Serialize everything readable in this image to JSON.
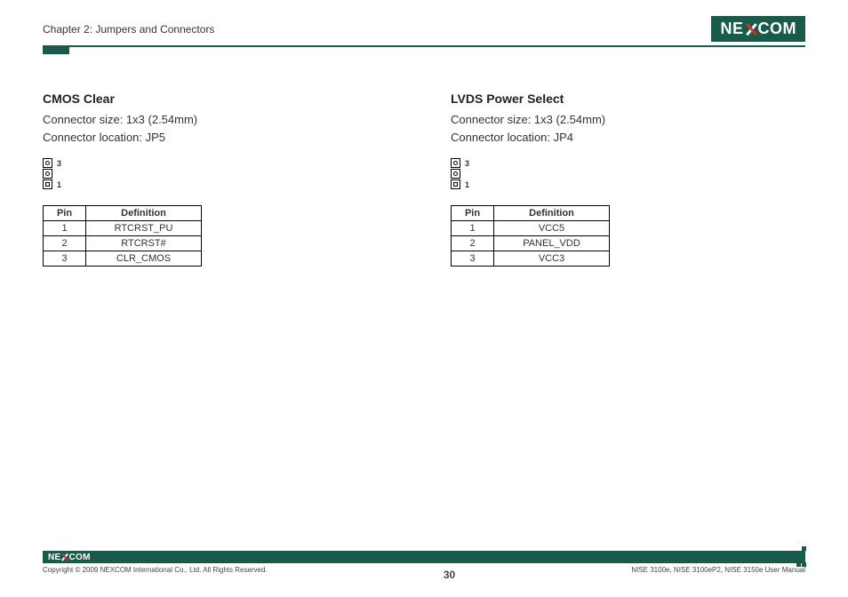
{
  "header": {
    "chapter": "Chapter 2: Jumpers and Connectors",
    "logo_left": "NE",
    "logo_right": "COM"
  },
  "sections": [
    {
      "title": "CMOS Clear",
      "size_line": "Connector size:  1x3 (2.54mm)",
      "loc_line": "Connector location: JP5",
      "pin_top": "3",
      "pin_bottom": "1",
      "headers": {
        "pin": "Pin",
        "def": "Definition"
      },
      "rows": [
        {
          "pin": "1",
          "def": "RTCRST_PU"
        },
        {
          "pin": "2",
          "def": "RTCRST#"
        },
        {
          "pin": "3",
          "def": "CLR_CMOS"
        }
      ]
    },
    {
      "title": "LVDS Power Select",
      "size_line": "Connector size:  1x3 (2.54mm)",
      "loc_line": "Connector location: JP4",
      "pin_top": "3",
      "pin_bottom": "1",
      "headers": {
        "pin": "Pin",
        "def": "Definition"
      },
      "rows": [
        {
          "pin": "1",
          "def": "VCC5"
        },
        {
          "pin": "2",
          "def": "PANEL_VDD"
        },
        {
          "pin": "3",
          "def": "VCC3"
        }
      ]
    }
  ],
  "footer": {
    "copyright": "Copyright © 2009 NEXCOM International Co., Ltd. All Rights Reserved.",
    "page_num": "30",
    "manual": "NISE 3100e, NISE 3100eP2, NISE 3150e User Manual"
  }
}
